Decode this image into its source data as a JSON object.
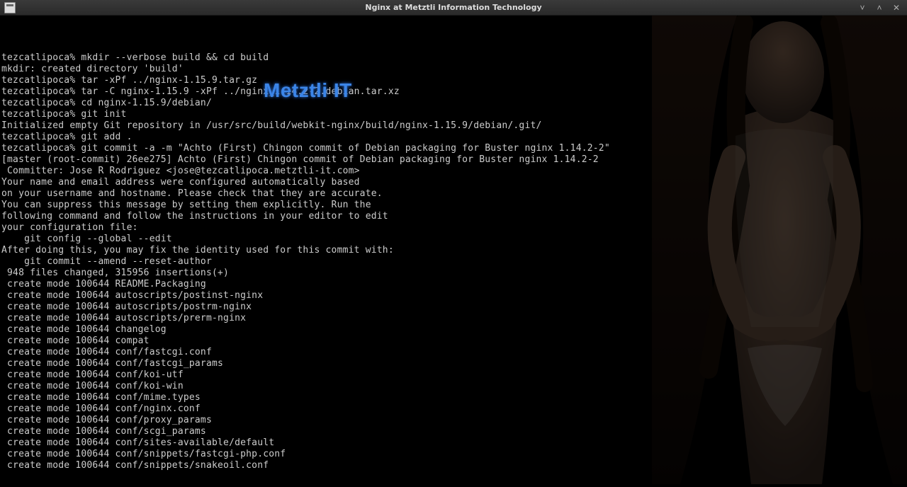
{
  "window": {
    "title": "Nginx at Metztli Information Technology"
  },
  "watermark": "Metztli IT",
  "prompt": "tezcatlipoca%",
  "lines": [
    "tezcatlipoca% mkdir --verbose build && cd build",
    "mkdir: created directory 'build'",
    "tezcatlipoca% tar -xPf ../nginx-1.15.9.tar.gz",
    "tezcatlipoca% tar -C nginx-1.15.9 -xPf ../nginx_1.14.2-2.debian.tar.xz",
    "tezcatlipoca% cd nginx-1.15.9/debian/",
    "tezcatlipoca% git init",
    "Initialized empty Git repository in /usr/src/build/webkit-nginx/build/nginx-1.15.9/debian/.git/",
    "tezcatlipoca% git add .",
    "tezcatlipoca% git commit -a -m \"Achto (First) Chingon commit of Debian packaging for Buster nginx 1.14.2-2\"",
    "[master (root-commit) 26ee275] Achto (First) Chingon commit of Debian packaging for Buster nginx 1.14.2-2",
    " Committer: Jose R Rodriguez <jose@tezcatlipoca.metztli-it.com>",
    "Your name and email address were configured automatically based",
    "on your username and hostname. Please check that they are accurate.",
    "You can suppress this message by setting them explicitly. Run the",
    "following command and follow the instructions in your editor to edit",
    "your configuration file:",
    "",
    "    git config --global --edit",
    "",
    "After doing this, you may fix the identity used for this commit with:",
    "",
    "    git commit --amend --reset-author",
    "",
    " 948 files changed, 315956 insertions(+)",
    " create mode 100644 README.Packaging",
    " create mode 100644 autoscripts/postinst-nginx",
    " create mode 100644 autoscripts/postrm-nginx",
    " create mode 100644 autoscripts/prerm-nginx",
    " create mode 100644 changelog",
    " create mode 100644 compat",
    " create mode 100644 conf/fastcgi.conf",
    " create mode 100644 conf/fastcgi_params",
    " create mode 100644 conf/koi-utf",
    " create mode 100644 conf/koi-win",
    " create mode 100644 conf/mime.types",
    " create mode 100644 conf/nginx.conf",
    " create mode 100644 conf/proxy_params",
    " create mode 100644 conf/scgi_params",
    " create mode 100644 conf/sites-available/default",
    " create mode 100644 conf/snippets/fastcgi-php.conf",
    " create mode 100644 conf/snippets/snakeoil.conf"
  ]
}
